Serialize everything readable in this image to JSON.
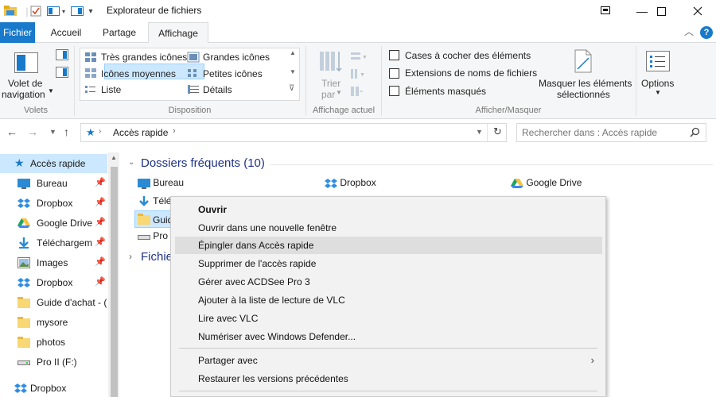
{
  "window": {
    "title": "Explorateur de fichiers"
  },
  "ribbon_tabs": [
    "Fichier",
    "Accueil",
    "Partage",
    "Affichage"
  ],
  "ribbon": {
    "volets": {
      "nav_label": "Volet de",
      "nav_label2": "navigation",
      "group": "Volets"
    },
    "disposition": {
      "items": [
        "Très grandes icônes",
        "Grandes icônes",
        "Icônes moyennes",
        "Petites icônes",
        "Liste",
        "Détails"
      ],
      "group": "Disposition",
      "selected": "Petites icônes"
    },
    "affichage_actuel": {
      "sort_label": "Trier",
      "sort_label2": "par",
      "group": "Affichage actuel"
    },
    "afficher_masquer": {
      "checkboxes": [
        "Cases à cocher des éléments",
        "Extensions de noms de fichiers",
        "Éléments masqués"
      ],
      "hide_label": "Masquer les éléments",
      "hide_label2": "sélectionnés",
      "group": "Afficher/Masquer"
    },
    "options_label": "Options"
  },
  "navigation": {
    "breadcrumb": "Accès rapide",
    "search_placeholder": "Rechercher dans : Accès rapide"
  },
  "sidebar": {
    "items": [
      {
        "label": "Accès rapide",
        "pinned": false
      },
      {
        "label": "Bureau",
        "pinned": true
      },
      {
        "label": "Dropbox",
        "pinned": true
      },
      {
        "label": "Google Drive",
        "pinned": true
      },
      {
        "label": "Téléchargem",
        "pinned": true
      },
      {
        "label": "Images",
        "pinned": true
      },
      {
        "label": "Dropbox",
        "pinned": true
      },
      {
        "label": "Guide d'achat - (",
        "pinned": false
      },
      {
        "label": "mysore",
        "pinned": false
      },
      {
        "label": "photos",
        "pinned": false
      },
      {
        "label": "Pro II (F:)",
        "pinned": false
      },
      {
        "label": "Dropbox",
        "pinned": false
      }
    ]
  },
  "content": {
    "frequent_title": "Dossiers fréquents (10)",
    "recent_title": "Fichie",
    "tiles": [
      "Bureau",
      "Dropbox",
      "Google Drive",
      "Télé",
      "Guid",
      "Pro"
    ]
  },
  "context_menu": {
    "items": [
      "Ouvrir",
      "Ouvrir dans une nouvelle fenêtre",
      "Épingler dans Accès rapide",
      "Supprimer de l'accès rapide",
      "Gérer avec ACDSee Pro 3",
      "Ajouter à la liste de lecture de VLC",
      "Lire avec VLC",
      "Numériser avec Windows Defender...",
      "Partager avec",
      "Restaurer les versions précédentes"
    ],
    "highlighted": "Épingler dans Accès rapide"
  },
  "colors": {
    "accent": "#1979ca",
    "selection": "#cce8ff",
    "menu_bg": "#f2f2f2",
    "section_title": "#1e3287"
  }
}
